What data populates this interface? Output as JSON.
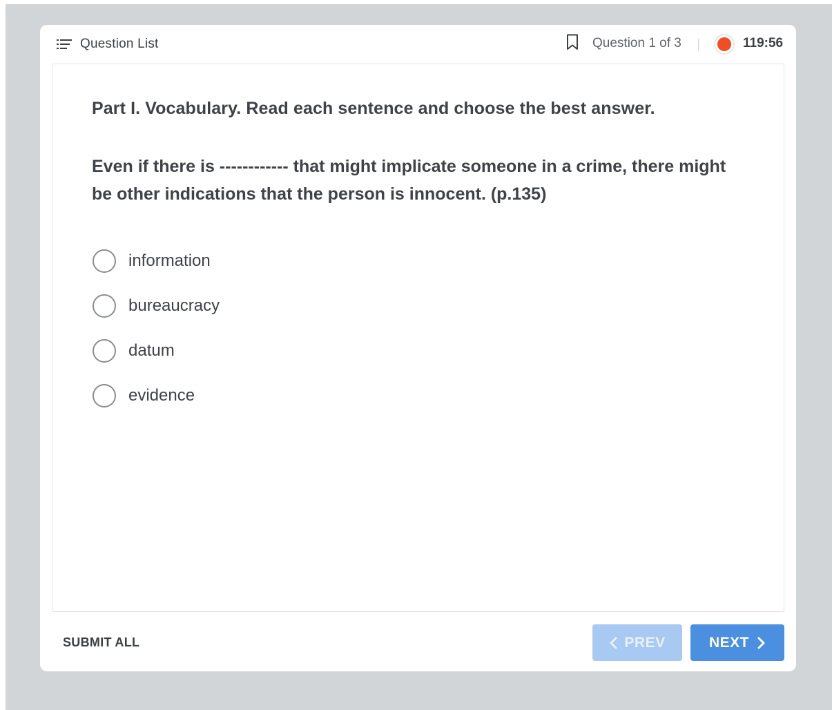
{
  "header": {
    "question_list_label": "Question List",
    "question_counter": "Question 1 of 3",
    "timer": "119:56"
  },
  "question": {
    "part_title": "Part I. Vocabulary. Read each sentence and choose the best answer.",
    "text": "Even if there is ------------ that might implicate someone in a crime, there might be other indications that the person is innocent. (p.135)",
    "options": [
      {
        "label": "information"
      },
      {
        "label": "bureaucracy"
      },
      {
        "label": "datum"
      },
      {
        "label": "evidence"
      }
    ]
  },
  "footer": {
    "submit_all_label": "SUBMIT ALL",
    "prev_label": "PREV",
    "next_label": "NEXT"
  },
  "colors": {
    "accent": "#4a8fe0",
    "accent_disabled": "#a8c9f2",
    "timer_dot": "#f04e23",
    "backdrop": "#d2d5d8"
  },
  "icons": {
    "question_list": "list-icon",
    "bookmark": "bookmark-icon",
    "timer": "record-dot-icon",
    "prev": "chevron-left-icon",
    "next": "chevron-right-icon"
  }
}
